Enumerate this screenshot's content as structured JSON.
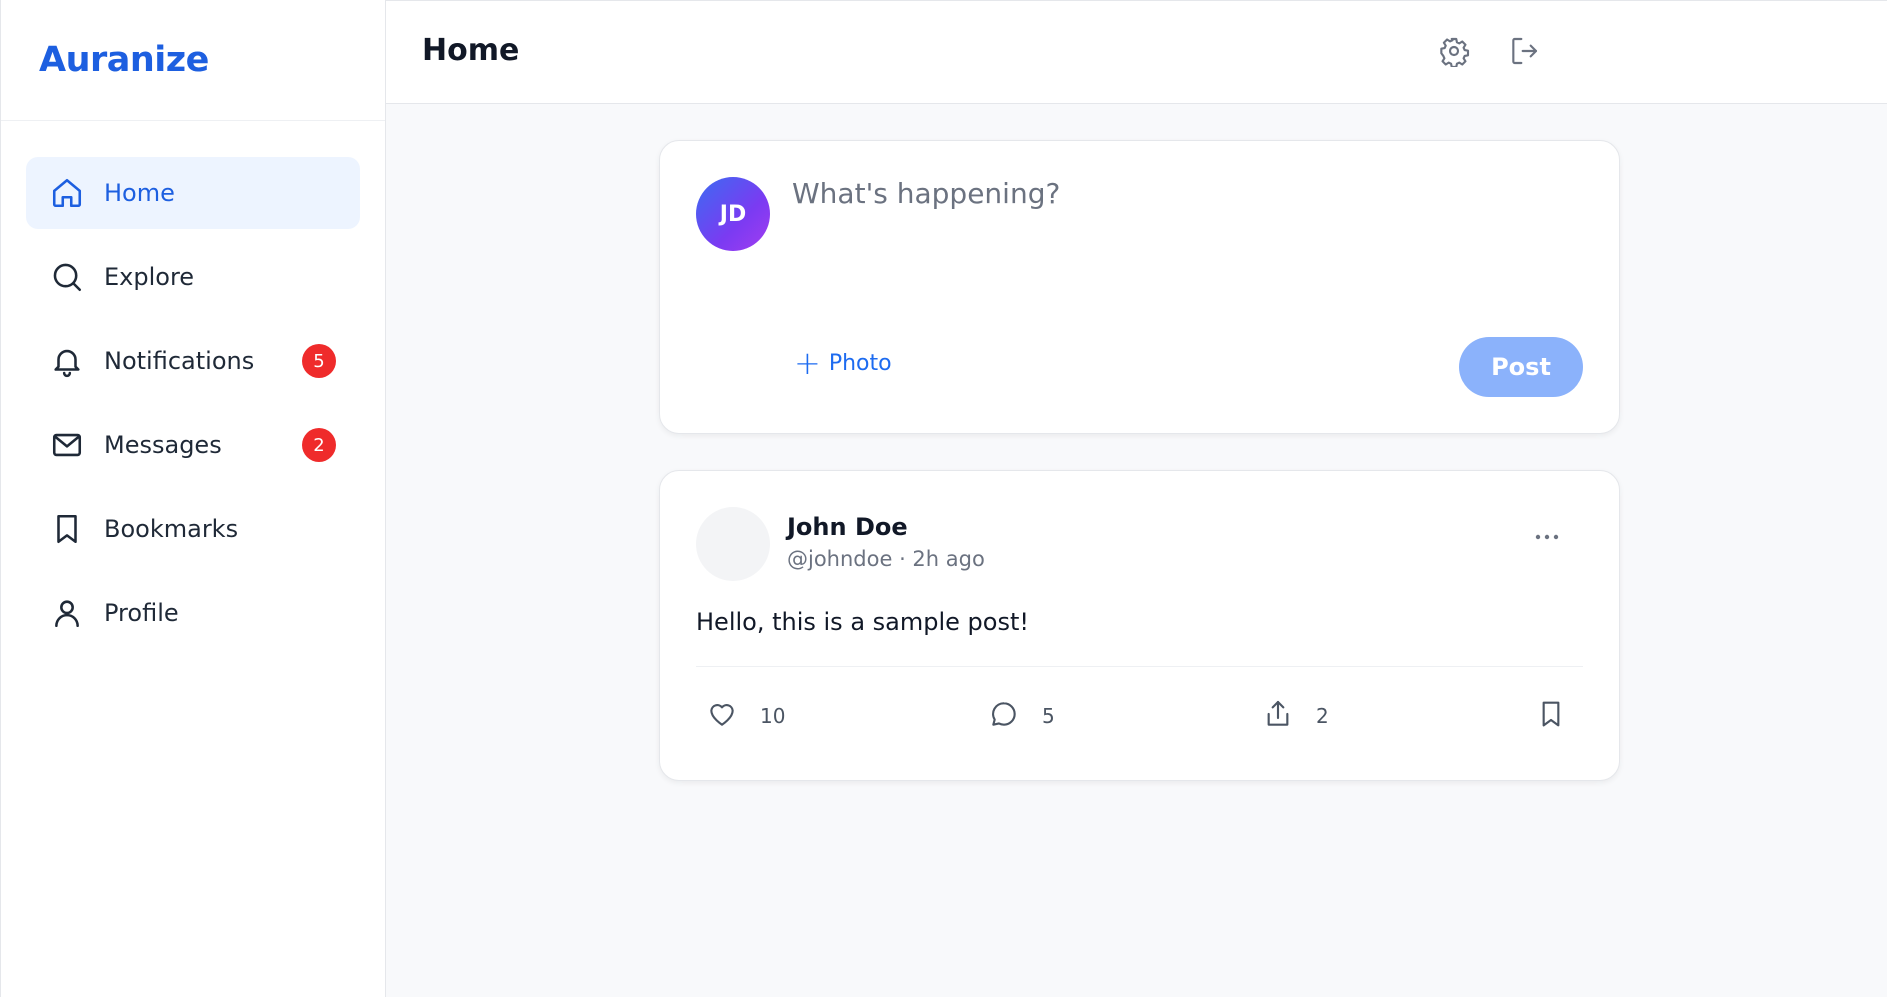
{
  "app": {
    "brand": "Auranize"
  },
  "sidebar": {
    "items": [
      {
        "label": "Home",
        "icon": "home-icon",
        "active": true
      },
      {
        "label": "Explore",
        "icon": "search-icon"
      },
      {
        "label": "Notifications",
        "icon": "bell-icon",
        "badge": "5"
      },
      {
        "label": "Messages",
        "icon": "mail-icon",
        "badge": "2"
      },
      {
        "label": "Bookmarks",
        "icon": "bookmark-icon"
      },
      {
        "label": "Profile",
        "icon": "user-icon"
      }
    ]
  },
  "header": {
    "title": "Home",
    "icons": [
      "gear-icon",
      "logout-icon"
    ]
  },
  "composer": {
    "avatar_initials": "JD",
    "placeholder": "What's happening?",
    "value": "",
    "photo_label": "Photo",
    "post_label": "Post"
  },
  "post": {
    "author": "John Doe",
    "meta": "@johndoe · 2h ago",
    "body": "Hello, this is a sample post!",
    "likes": "10",
    "comments": "5",
    "shares": "2"
  },
  "colors": {
    "accent": "#1d5fe0",
    "active_bg": "#edf4ff",
    "badge": "#ef2b2b",
    "post_button": "#8bb2fb"
  }
}
